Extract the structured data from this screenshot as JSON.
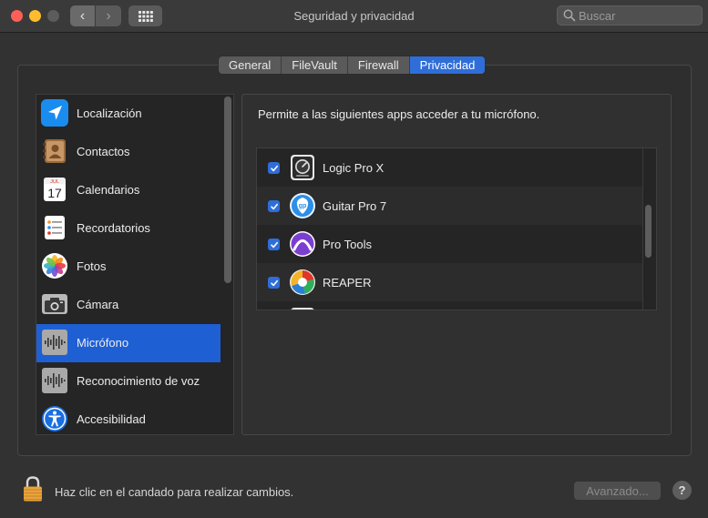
{
  "window": {
    "title": "Seguridad y privacidad",
    "search_placeholder": "Buscar",
    "nav_back_glyph": "‹",
    "nav_forward_glyph": "›"
  },
  "tabs": [
    {
      "label": "General",
      "active": false
    },
    {
      "label": "FileVault",
      "active": false
    },
    {
      "label": "Firewall",
      "active": false
    },
    {
      "label": "Privacidad",
      "active": true
    }
  ],
  "sidebar": {
    "items": [
      {
        "label": "Localización",
        "icon": "location-icon",
        "selected": false
      },
      {
        "label": "Contactos",
        "icon": "contacts-icon",
        "selected": false
      },
      {
        "label": "Calendarios",
        "icon": "calendar-icon",
        "selected": false,
        "icon_text": {
          "month": "JUL",
          "day": "17"
        }
      },
      {
        "label": "Recordatorios",
        "icon": "reminders-icon",
        "selected": false
      },
      {
        "label": "Fotos",
        "icon": "photos-icon",
        "selected": false
      },
      {
        "label": "Cámara",
        "icon": "camera-icon",
        "selected": false
      },
      {
        "label": "Micrófono",
        "icon": "microphone-icon",
        "selected": true
      },
      {
        "label": "Reconocimiento de voz",
        "icon": "speech-recognition-icon",
        "selected": false
      },
      {
        "label": "Accesibilidad",
        "icon": "accessibility-icon",
        "selected": false
      }
    ]
  },
  "panel": {
    "description": "Permite a las siguientes apps acceder a tu micrófono.",
    "apps": [
      {
        "label": "Logic Pro X",
        "checked": true,
        "icon": "logic-pro-icon"
      },
      {
        "label": "Guitar Pro 7",
        "checked": true,
        "icon": "guitar-pro-icon",
        "icon_text": "gp"
      },
      {
        "label": "Pro Tools",
        "checked": true,
        "icon": "pro-tools-icon"
      },
      {
        "label": "REAPER",
        "checked": true,
        "icon": "reaper-icon"
      }
    ]
  },
  "footer": {
    "lock_text": "Haz clic en el candado para realizar cambios.",
    "advanced_label": "Avanzado...",
    "help_label": "?"
  },
  "colors": {
    "accent": "#2f6ed9",
    "selection": "#1f5fd4",
    "background": "#323232",
    "lock": "#e8a33a"
  }
}
